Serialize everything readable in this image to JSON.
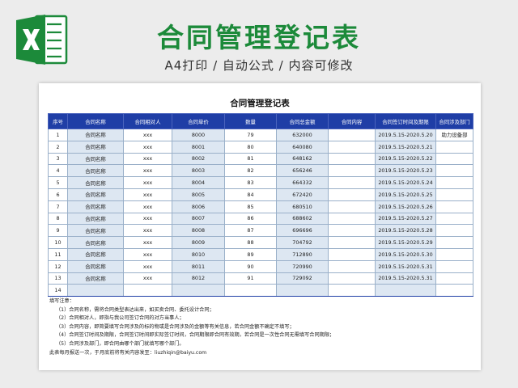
{
  "header": {
    "title": "合同管理登记表",
    "subtitle": "A4打印 / 自动公式 / 内容可修改",
    "logo_icon": "excel-icon",
    "brand_color": "#1c8a3a"
  },
  "sheet": {
    "title": "合同管理登记表",
    "columns": [
      "序号",
      "合同名称",
      "合同相对人",
      "合同单价",
      "数量",
      "合同总金额",
      "合同内容",
      "合同签订时间及期限",
      "合同涉及部门"
    ],
    "header_color": "#1f3ea6",
    "rows": [
      [
        "1",
        "合同名称",
        "xxx",
        "8000",
        "79",
        "632000",
        "",
        "2019.5.15-2020.5.20",
        "助力设备部"
      ],
      [
        "2",
        "合同名称",
        "xxx",
        "8001",
        "80",
        "640080",
        "",
        "2019.5.15-2020.5.21",
        ""
      ],
      [
        "3",
        "合同名称",
        "xxx",
        "8002",
        "81",
        "648162",
        "",
        "2019.5.15-2020.5.22",
        ""
      ],
      [
        "4",
        "合同名称",
        "xxx",
        "8003",
        "82",
        "656246",
        "",
        "2019.5.15-2020.5.23",
        ""
      ],
      [
        "5",
        "合同名称",
        "xxx",
        "8004",
        "83",
        "664332",
        "",
        "2019.5.15-2020.5.24",
        ""
      ],
      [
        "6",
        "合同名称",
        "xxx",
        "8005",
        "84",
        "672420",
        "",
        "2019.5.15-2020.5.25",
        ""
      ],
      [
        "7",
        "合同名称",
        "xxx",
        "8006",
        "85",
        "680510",
        "",
        "2019.5.15-2020.5.26",
        ""
      ],
      [
        "8",
        "合同名称",
        "xxx",
        "8007",
        "86",
        "688602",
        "",
        "2019.5.15-2020.5.27",
        ""
      ],
      [
        "9",
        "合同名称",
        "xxx",
        "8008",
        "87",
        "696696",
        "",
        "2019.5.15-2020.5.28",
        ""
      ],
      [
        "10",
        "合同名称",
        "xxx",
        "8009",
        "88",
        "704792",
        "",
        "2019.5.15-2020.5.29",
        ""
      ],
      [
        "11",
        "合同名称",
        "xxx",
        "8010",
        "89",
        "712890",
        "",
        "2019.5.15-2020.5.30",
        ""
      ],
      [
        "12",
        "合同名称",
        "xxx",
        "8011",
        "90",
        "720990",
        "",
        "2019.5.15-2020.5.31",
        ""
      ],
      [
        "13",
        "合同名称",
        "xxx",
        "8012",
        "91",
        "729092",
        "",
        "2019.5.15-2020.5.31",
        ""
      ],
      [
        "14",
        "",
        "",
        "",
        "",
        "",
        "",
        "",
        ""
      ]
    ],
    "notes": {
      "heading": "填写注意：",
      "items": [
        "（1）合同名称，需将合同类型表达出来，如买卖合同、委托设计合同；",
        "（2）合同相对人，即指与我公司签订合同的对方当事人；",
        "（3）合同内容，即简要填写合同涉及的标的物或是合同涉及的金额等有关信息，若合同金额不确定不填写；",
        "（4）合同签订时间及期限，合同签订时间即实际签订时间，合同期限即合同有效期，若合同是一次性合同无需填写合同期限；",
        "（5）合同涉及部门，即合同由哪个部门就填写哪个部门。"
      ],
      "footer": "此表每月报送一次，于月底前将有关内容发至：liuzhiqin@baiyu.com"
    }
  }
}
